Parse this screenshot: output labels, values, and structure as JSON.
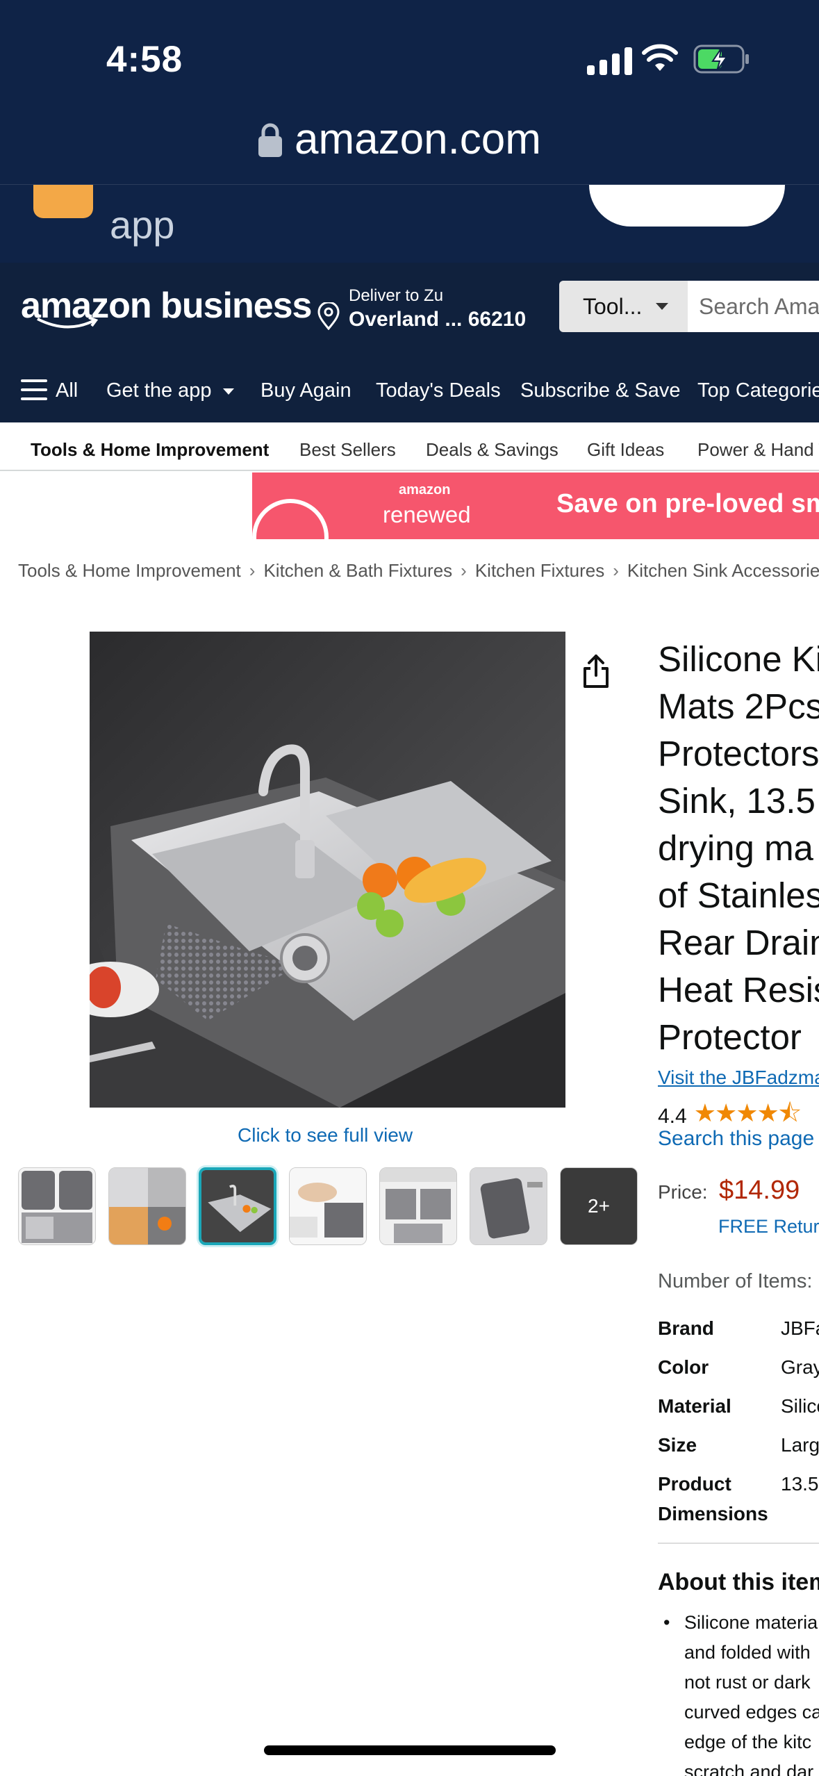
{
  "status_bar": {
    "time": "4:58"
  },
  "browser": {
    "url": "amazon.com"
  },
  "app_promo": {
    "text": "app"
  },
  "header": {
    "logo": "amazon business",
    "deliver_line1": "Deliver to Zu",
    "deliver_line2": "Overland ... 66210",
    "search_category": "Tool...",
    "search_placeholder": "Search Amazon"
  },
  "nav": {
    "items": [
      "All",
      "Get the app",
      "Buy Again",
      "Today's Deals",
      "Subscribe & Save",
      "Top Categories"
    ]
  },
  "subnav": {
    "items": [
      "Tools & Home Improvement",
      "Best Sellers",
      "Deals & Savings",
      "Gift Ideas",
      "Power & Hand Tools"
    ]
  },
  "banner": {
    "brand": "amazon",
    "renewed": "renewed",
    "headline": "Save on pre-loved smartphones"
  },
  "breadcrumb": [
    "Tools & Home Improvement",
    "Kitchen & Bath Fixtures",
    "Kitchen Fixtures",
    "Kitchen Sink Accessories"
  ],
  "gallery": {
    "full_view": "Click to see full view",
    "more_label": "2+"
  },
  "product": {
    "title_lines": [
      "Silicone Ki",
      "Mats 2Pcs",
      "Protectors",
      "Sink, 13.5",
      "drying ma",
      "of Stainles",
      "Rear Drain",
      "Heat Resis",
      "Protector"
    ],
    "visit_store": "Visit the JBFadzmart Store",
    "rating": "4.4",
    "stars": "★★★★⯪",
    "search_page": "Search this page",
    "price_label": "Price:",
    "price": "$14.99",
    "free_returns": "FREE Returns",
    "number_of_items": "Number of Items:",
    "specs": [
      {
        "key": "Brand",
        "value": "JBFadzmart"
      },
      {
        "key": "Color",
        "value": "Gray"
      },
      {
        "key": "Material",
        "value": "Silicone"
      },
      {
        "key": "Size",
        "value": "Large"
      },
      {
        "key": "Product",
        "key2": "Dimensions",
        "value": "13.5"
      }
    ],
    "about_heading": "About this item",
    "bullet_lines": [
      "Silicone materia",
      "and folded with",
      "not rust or dark",
      "curved edges ca",
      "edge of the kitc",
      "scratch and dar"
    ]
  }
}
